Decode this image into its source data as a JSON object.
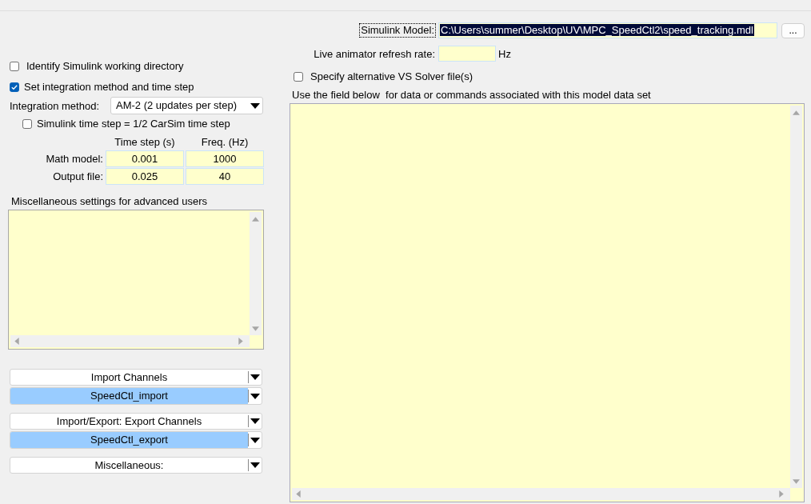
{
  "simulink_model": {
    "label": "Simulink Model:",
    "focused": true,
    "value": "C:\\Users\\summer\\Desktop\\UV\\MPC_SpeedCtl2\\speed_tracking.mdl",
    "value_selected": true,
    "browse_button": "..."
  },
  "live_animator": {
    "label": "Live animator refresh rate:",
    "unit": "Hz"
  },
  "alternative_solver": {
    "label": "Specify alternative VS Solver file(s)",
    "checked": false
  },
  "commands_field": {
    "label": "Use the field below  for data or commands associated with this model data set"
  },
  "working_directory": {
    "label": "Identify Simulink working directory",
    "checked": false
  },
  "integration": {
    "label": "Set integration method and time step",
    "checked": true,
    "method_label": "Integration method:",
    "method": "AM-2 (2 updates per step)"
  },
  "half_time_step": {
    "label": "Simulink time step = 1/2 CarSim time step",
    "checked": false
  },
  "time_steps": {
    "columns": [
      "Time step (s)",
      "Freq. (Hz)"
    ],
    "rows": [
      {
        "label": "Math model:",
        "values": [
          "0.001",
          "1000"
        ]
      },
      {
        "label": "Output file:",
        "values": [
          "0.025",
          "40"
        ]
      }
    ]
  },
  "advanced_settings": {
    "label": "Miscellaneous settings for advanced users"
  },
  "channel_groups": [
    {
      "category": "Import Channels",
      "dataset": "SpeedCtl_import"
    },
    {
      "category": "Import/Export: Export Channels",
      "dataset": "SpeedCtl_export"
    },
    {
      "category": "Miscellaneous:"
    }
  ]
}
